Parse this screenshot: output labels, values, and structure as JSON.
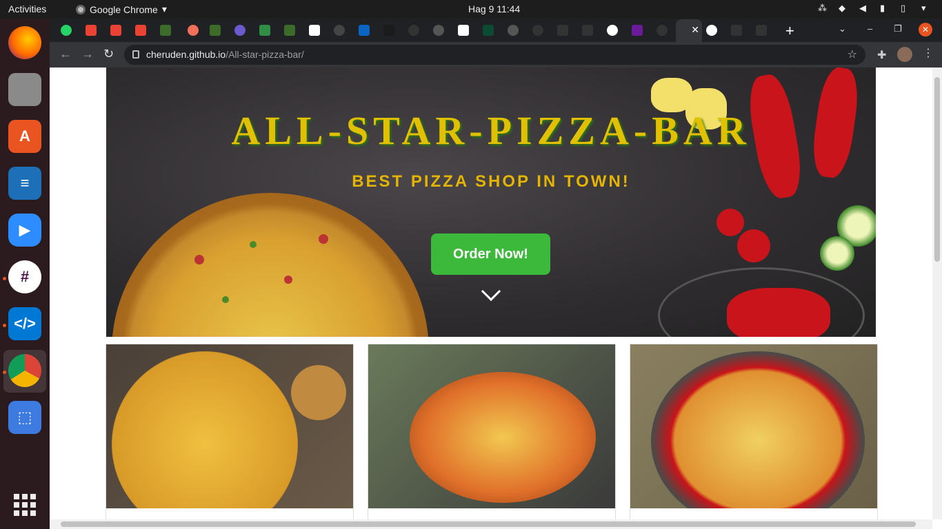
{
  "system": {
    "activities": "Activities",
    "app_name": "Google Chrome",
    "clock": "Hag 9  11:44"
  },
  "browser": {
    "url_host": "cheruden.github.io",
    "url_path": "/All-star-pizza-bar/",
    "new_tab_symbol": "+",
    "close_tab_symbol": "✕"
  },
  "hero": {
    "title": "ALL-STAR-PIZZA-BAR",
    "subtitle": "BEST PIZZA SHOP IN TOWN!",
    "cta_label": "Order Now!"
  },
  "colors": {
    "title": "#e0c000",
    "subtitle": "#e4b400",
    "cta": "#3cb93a",
    "ubuntu_accent": "#e95420"
  },
  "icons": {
    "dock": [
      "firefox-icon",
      "files-icon",
      "software-center-icon",
      "libreoffice-writer-icon",
      "zoom-icon",
      "slack-icon",
      "vscode-icon",
      "chrome-icon",
      "screenshot-icon",
      "show-apps-icon"
    ],
    "tray": [
      "network-icon",
      "wifi-icon",
      "volume-icon",
      "microphone-icon",
      "battery-icon",
      "dropdown-icon"
    ]
  }
}
